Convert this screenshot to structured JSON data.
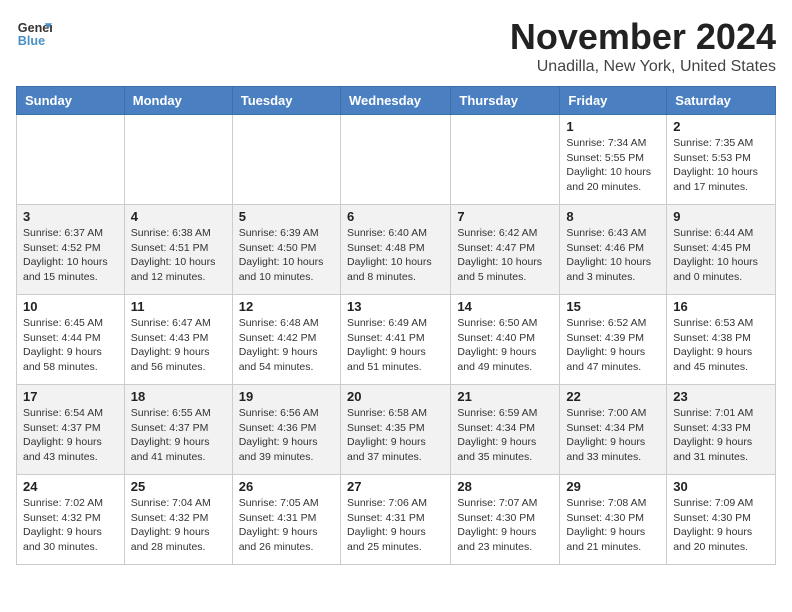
{
  "logo": {
    "line1": "General",
    "line2": "Blue"
  },
  "title": "November 2024",
  "subtitle": "Unadilla, New York, United States",
  "days_header": [
    "Sunday",
    "Monday",
    "Tuesday",
    "Wednesday",
    "Thursday",
    "Friday",
    "Saturday"
  ],
  "weeks": [
    [
      {
        "day": "",
        "info": ""
      },
      {
        "day": "",
        "info": ""
      },
      {
        "day": "",
        "info": ""
      },
      {
        "day": "",
        "info": ""
      },
      {
        "day": "",
        "info": ""
      },
      {
        "day": "1",
        "info": "Sunrise: 7:34 AM\nSunset: 5:55 PM\nDaylight: 10 hours\nand 20 minutes."
      },
      {
        "day": "2",
        "info": "Sunrise: 7:35 AM\nSunset: 5:53 PM\nDaylight: 10 hours\nand 17 minutes."
      }
    ],
    [
      {
        "day": "3",
        "info": "Sunrise: 6:37 AM\nSunset: 4:52 PM\nDaylight: 10 hours\nand 15 minutes."
      },
      {
        "day": "4",
        "info": "Sunrise: 6:38 AM\nSunset: 4:51 PM\nDaylight: 10 hours\nand 12 minutes."
      },
      {
        "day": "5",
        "info": "Sunrise: 6:39 AM\nSunset: 4:50 PM\nDaylight: 10 hours\nand 10 minutes."
      },
      {
        "day": "6",
        "info": "Sunrise: 6:40 AM\nSunset: 4:48 PM\nDaylight: 10 hours\nand 8 minutes."
      },
      {
        "day": "7",
        "info": "Sunrise: 6:42 AM\nSunset: 4:47 PM\nDaylight: 10 hours\nand 5 minutes."
      },
      {
        "day": "8",
        "info": "Sunrise: 6:43 AM\nSunset: 4:46 PM\nDaylight: 10 hours\nand 3 minutes."
      },
      {
        "day": "9",
        "info": "Sunrise: 6:44 AM\nSunset: 4:45 PM\nDaylight: 10 hours\nand 0 minutes."
      }
    ],
    [
      {
        "day": "10",
        "info": "Sunrise: 6:45 AM\nSunset: 4:44 PM\nDaylight: 9 hours\nand 58 minutes."
      },
      {
        "day": "11",
        "info": "Sunrise: 6:47 AM\nSunset: 4:43 PM\nDaylight: 9 hours\nand 56 minutes."
      },
      {
        "day": "12",
        "info": "Sunrise: 6:48 AM\nSunset: 4:42 PM\nDaylight: 9 hours\nand 54 minutes."
      },
      {
        "day": "13",
        "info": "Sunrise: 6:49 AM\nSunset: 4:41 PM\nDaylight: 9 hours\nand 51 minutes."
      },
      {
        "day": "14",
        "info": "Sunrise: 6:50 AM\nSunset: 4:40 PM\nDaylight: 9 hours\nand 49 minutes."
      },
      {
        "day": "15",
        "info": "Sunrise: 6:52 AM\nSunset: 4:39 PM\nDaylight: 9 hours\nand 47 minutes."
      },
      {
        "day": "16",
        "info": "Sunrise: 6:53 AM\nSunset: 4:38 PM\nDaylight: 9 hours\nand 45 minutes."
      }
    ],
    [
      {
        "day": "17",
        "info": "Sunrise: 6:54 AM\nSunset: 4:37 PM\nDaylight: 9 hours\nand 43 minutes."
      },
      {
        "day": "18",
        "info": "Sunrise: 6:55 AM\nSunset: 4:37 PM\nDaylight: 9 hours\nand 41 minutes."
      },
      {
        "day": "19",
        "info": "Sunrise: 6:56 AM\nSunset: 4:36 PM\nDaylight: 9 hours\nand 39 minutes."
      },
      {
        "day": "20",
        "info": "Sunrise: 6:58 AM\nSunset: 4:35 PM\nDaylight: 9 hours\nand 37 minutes."
      },
      {
        "day": "21",
        "info": "Sunrise: 6:59 AM\nSunset: 4:34 PM\nDaylight: 9 hours\nand 35 minutes."
      },
      {
        "day": "22",
        "info": "Sunrise: 7:00 AM\nSunset: 4:34 PM\nDaylight: 9 hours\nand 33 minutes."
      },
      {
        "day": "23",
        "info": "Sunrise: 7:01 AM\nSunset: 4:33 PM\nDaylight: 9 hours\nand 31 minutes."
      }
    ],
    [
      {
        "day": "24",
        "info": "Sunrise: 7:02 AM\nSunset: 4:32 PM\nDaylight: 9 hours\nand 30 minutes."
      },
      {
        "day": "25",
        "info": "Sunrise: 7:04 AM\nSunset: 4:32 PM\nDaylight: 9 hours\nand 28 minutes."
      },
      {
        "day": "26",
        "info": "Sunrise: 7:05 AM\nSunset: 4:31 PM\nDaylight: 9 hours\nand 26 minutes."
      },
      {
        "day": "27",
        "info": "Sunrise: 7:06 AM\nSunset: 4:31 PM\nDaylight: 9 hours\nand 25 minutes."
      },
      {
        "day": "28",
        "info": "Sunrise: 7:07 AM\nSunset: 4:30 PM\nDaylight: 9 hours\nand 23 minutes."
      },
      {
        "day": "29",
        "info": "Sunrise: 7:08 AM\nSunset: 4:30 PM\nDaylight: 9 hours\nand 21 minutes."
      },
      {
        "day": "30",
        "info": "Sunrise: 7:09 AM\nSunset: 4:30 PM\nDaylight: 9 hours\nand 20 minutes."
      }
    ]
  ]
}
